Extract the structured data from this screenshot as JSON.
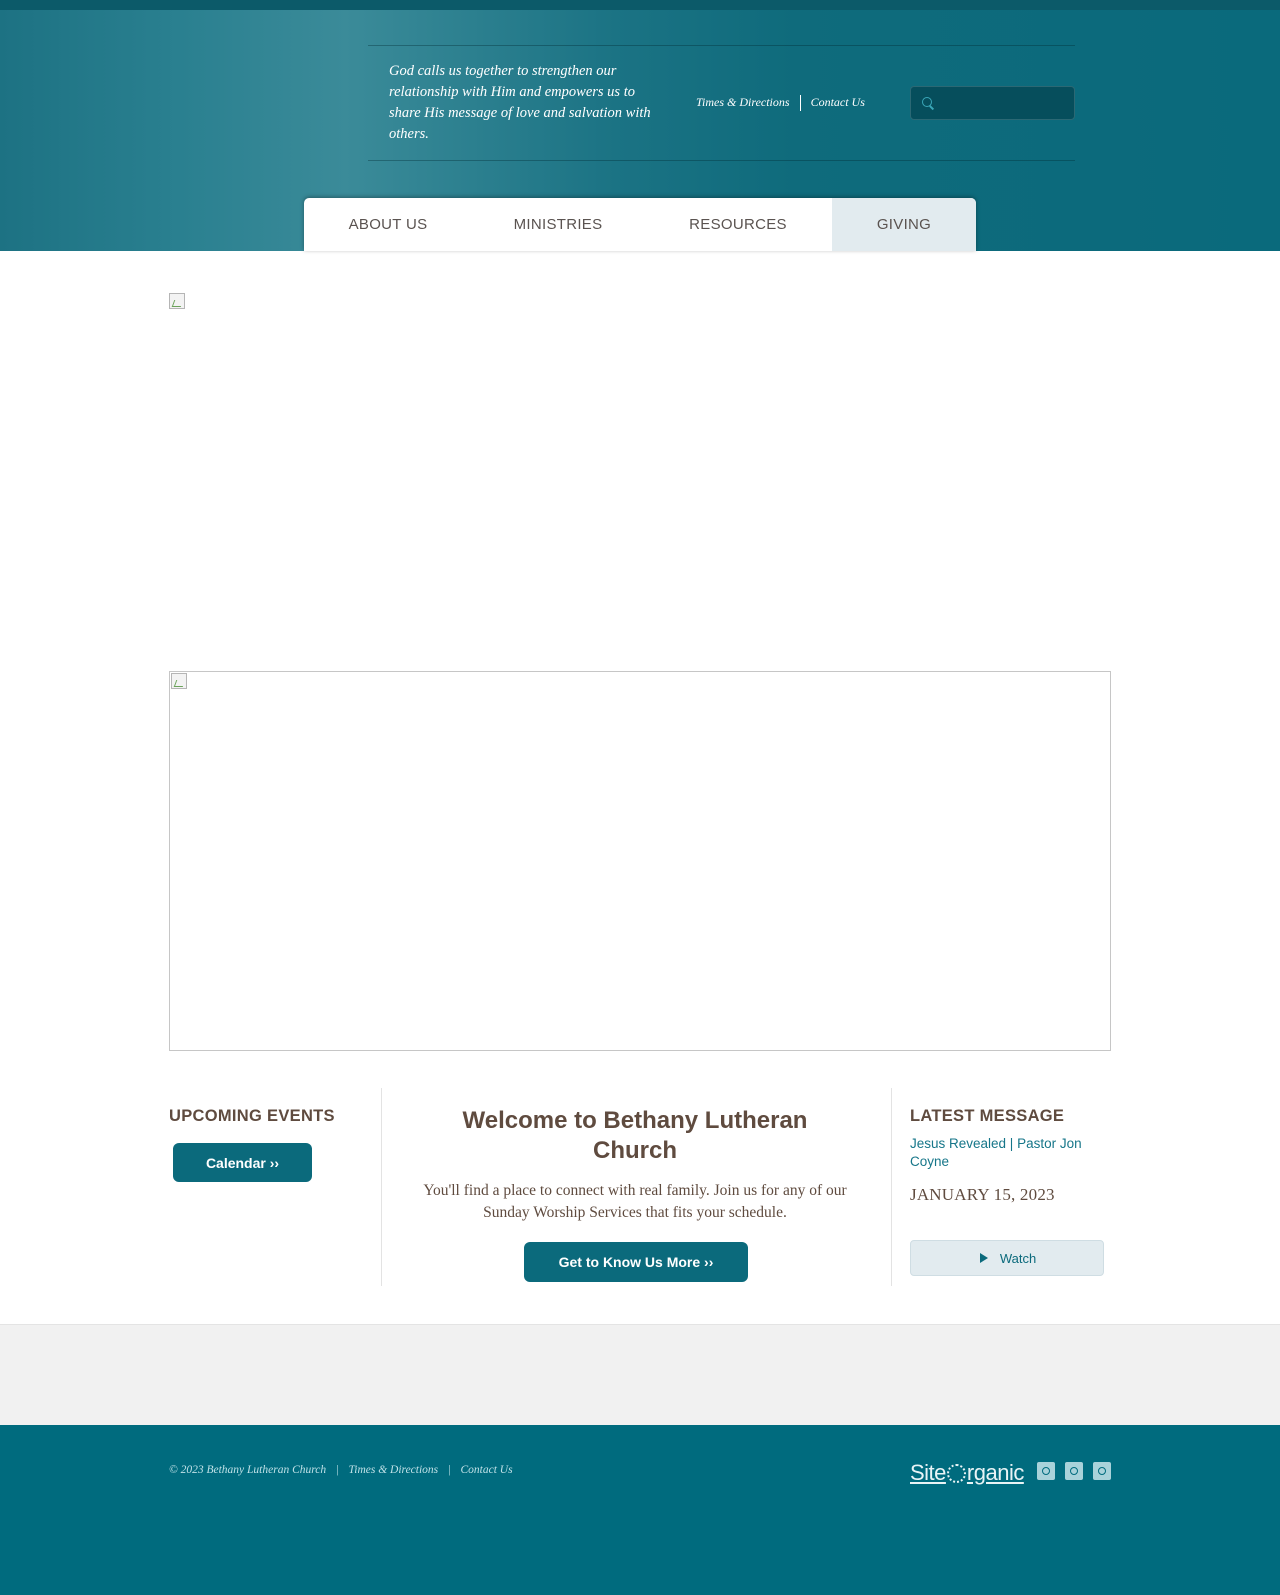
{
  "header": {
    "tagline": "God calls us together to strengthen our relationship with Him and empowers us to share His message of love and salvation with others.",
    "links": [
      "Times & Directions",
      "Contact Us"
    ],
    "search": {
      "placeholder": "",
      "icon": "search-icon"
    }
  },
  "nav": {
    "items": [
      "ABOUT US",
      "MINISTRIES",
      "RESOURCES",
      "GIVING"
    ],
    "active": "GIVING"
  },
  "events": {
    "title": "UPCOMING EVENTS",
    "calendar_button": "Calendar ››"
  },
  "welcome": {
    "title": "Welcome to  Bethany Lutheran Church",
    "text": "You'll find a place to connect with real family. Join us for any of our Sunday Worship Services that fits your schedule.",
    "button": "Get to Know Us More ››"
  },
  "message": {
    "title": "LATEST MESSAGE",
    "link": "Jesus Revealed | Pastor Jon Coyne",
    "date": "JANUARY 15, 2023",
    "watch_button": "Watch",
    "watch_icon": "play-icon"
  },
  "footer": {
    "copyright": "© 2023 Bethany Lutheran Church",
    "separator": "|",
    "links": [
      "Times & Directions",
      "Contact Us"
    ],
    "brand_left": "Site",
    "brand_right": "rganic",
    "social_icons": [
      "facebook-icon",
      "youtube-icon",
      "instagram-icon"
    ]
  },
  "colors": {
    "brand_teal": "#0b6a7c",
    "footer_teal": "#006b7e",
    "heading_brown": "#5f4b3f",
    "link_teal": "#167689",
    "active_nav_bg": "#e2ebef"
  }
}
